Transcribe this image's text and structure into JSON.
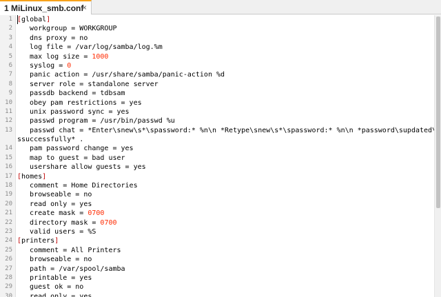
{
  "tab": {
    "title": "1 MiLinux_smb.conf",
    "close": "×"
  },
  "lines": [
    {
      "n": "1",
      "parts": [
        {
          "t": "[",
          "c": "br"
        },
        {
          "t": "global",
          "c": "sec"
        },
        {
          "t": "]",
          "c": "br"
        }
      ]
    },
    {
      "n": "2",
      "parts": [
        {
          "t": "   workgroup = WORKGROUP"
        }
      ]
    },
    {
      "n": "3",
      "parts": [
        {
          "t": "   dns proxy = no"
        }
      ]
    },
    {
      "n": "4",
      "parts": [
        {
          "t": "   log file = /var/log/samba/log.%m"
        }
      ]
    },
    {
      "n": "5",
      "parts": [
        {
          "t": "   max log size = "
        },
        {
          "t": "1000",
          "c": "num"
        }
      ]
    },
    {
      "n": "6",
      "parts": [
        {
          "t": "   syslog = "
        },
        {
          "t": "0",
          "c": "num"
        }
      ]
    },
    {
      "n": "7",
      "parts": [
        {
          "t": "   panic action = /usr/share/samba/panic-action %d"
        }
      ]
    },
    {
      "n": "8",
      "parts": [
        {
          "t": "   server role = standalone server"
        }
      ]
    },
    {
      "n": "9",
      "parts": [
        {
          "t": "   passdb backend = tdbsam"
        }
      ]
    },
    {
      "n": "10",
      "parts": [
        {
          "t": "   obey pam restrictions = yes"
        }
      ]
    },
    {
      "n": "11",
      "parts": [
        {
          "t": "   unix password sync = yes"
        }
      ]
    },
    {
      "n": "12",
      "parts": [
        {
          "t": "   passwd program = /usr/bin/passwd %u"
        }
      ]
    },
    {
      "n": "13",
      "parts": [
        {
          "t": "   passwd chat = *Enter\\snew\\s*\\spassword:* %n\\n *Retype\\snew\\s*\\spassword:* %n\\n *password\\supdated\\"
        }
      ]
    },
    {
      "n": "",
      "parts": [
        {
          "t": "ssuccessfully* ."
        }
      ]
    },
    {
      "n": "14",
      "parts": [
        {
          "t": "   pam password change = yes"
        }
      ]
    },
    {
      "n": "15",
      "parts": [
        {
          "t": "   map to guest = bad user"
        }
      ]
    },
    {
      "n": "16",
      "parts": [
        {
          "t": "   usershare allow guests = yes"
        }
      ]
    },
    {
      "n": "17",
      "parts": [
        {
          "t": "[",
          "c": "br"
        },
        {
          "t": "homes",
          "c": "sec"
        },
        {
          "t": "]",
          "c": "br"
        }
      ]
    },
    {
      "n": "18",
      "parts": [
        {
          "t": "   comment = Home Directories"
        }
      ]
    },
    {
      "n": "19",
      "parts": [
        {
          "t": "   browseable = no"
        }
      ]
    },
    {
      "n": "20",
      "parts": [
        {
          "t": "   read only = yes"
        }
      ]
    },
    {
      "n": "21",
      "parts": [
        {
          "t": "   create mask = "
        },
        {
          "t": "0700",
          "c": "num"
        }
      ]
    },
    {
      "n": "22",
      "parts": [
        {
          "t": "   directory mask = "
        },
        {
          "t": "0700",
          "c": "num"
        }
      ]
    },
    {
      "n": "23",
      "parts": [
        {
          "t": "   valid users = %S"
        }
      ]
    },
    {
      "n": "24",
      "parts": [
        {
          "t": "[",
          "c": "br"
        },
        {
          "t": "printers",
          "c": "sec"
        },
        {
          "t": "]",
          "c": "br"
        }
      ]
    },
    {
      "n": "25",
      "parts": [
        {
          "t": "   comment = All Printers"
        }
      ]
    },
    {
      "n": "26",
      "parts": [
        {
          "t": "   browseable = no"
        }
      ]
    },
    {
      "n": "27",
      "parts": [
        {
          "t": "   path = /var/spool/samba"
        }
      ]
    },
    {
      "n": "28",
      "parts": [
        {
          "t": "   printable = yes"
        }
      ]
    },
    {
      "n": "29",
      "parts": [
        {
          "t": "   guest ok = no"
        }
      ]
    },
    {
      "n": "30",
      "parts": [
        {
          "t": "   read only = yes"
        }
      ]
    }
  ]
}
